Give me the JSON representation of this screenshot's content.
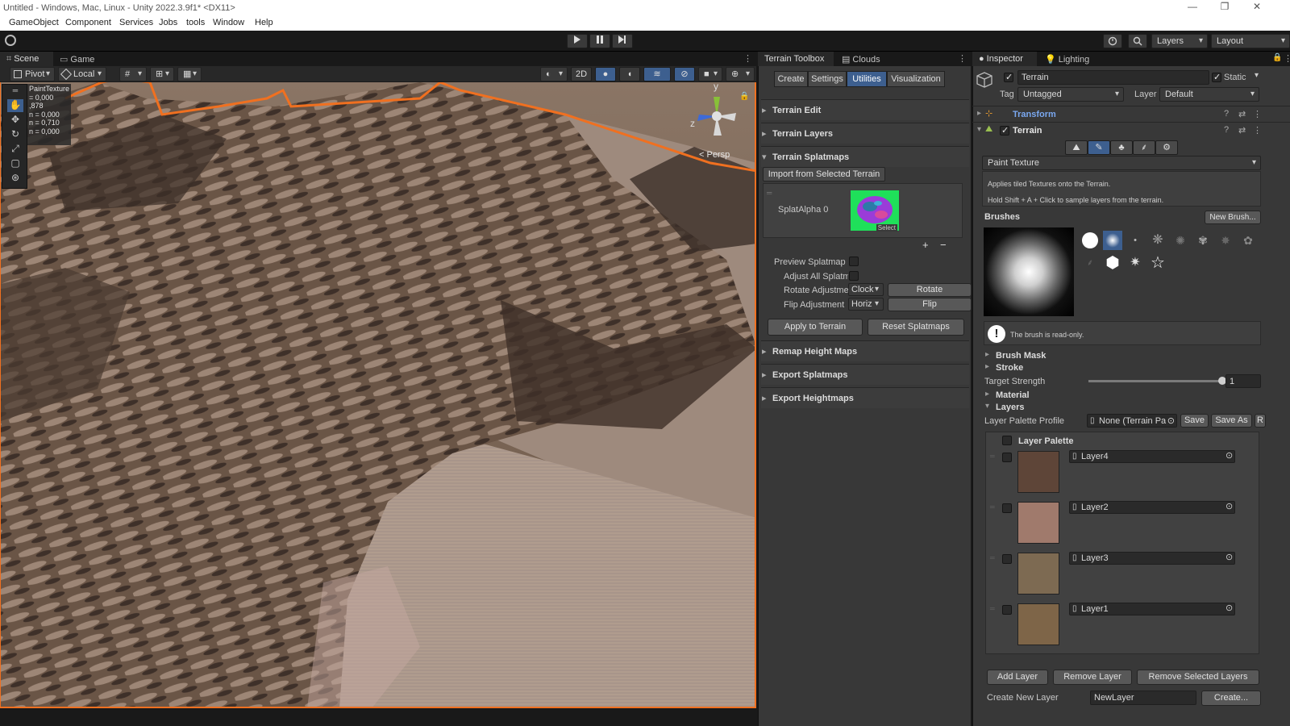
{
  "window": {
    "title": "Untitled - Windows, Mac, Linux - Unity 2022.3.9f1* <DX11>",
    "minimize_glyph": "—",
    "restore_glyph": "❐",
    "close_glyph": "✕"
  },
  "menu": [
    "GameObject",
    "Component",
    "Services",
    "Jobs",
    "tools",
    "Window",
    "Help"
  ],
  "toolbar": {
    "play_icon": "play-icon",
    "layers_label": "Layers",
    "layout_label": "Layout"
  },
  "scene": {
    "tab_scene": "Scene",
    "tab_game": "Game",
    "pivot_label": "Pivot",
    "local_label": "Local",
    "mode_2d": "2D",
    "persp_label": "< Persp",
    "gizmo_y": "y",
    "gizmo_z": "z",
    "info": [
      "PaintTexture",
      "= 0,000",
      ",878",
      "n = 0,000",
      "n = 0,710",
      "n = 0,000"
    ]
  },
  "toolbox": {
    "tab_terrain_toolbox": "Terrain Toolbox",
    "tab_clouds": "Clouds",
    "segments": [
      "Create",
      "Settings",
      "Utilities",
      "Visualization"
    ],
    "active_segment": "Utilities",
    "sections": {
      "terrain_edit": "Terrain Edit",
      "terrain_layers": "Terrain Layers",
      "terrain_splatmaps": "Terrain Splatmaps",
      "remap_height_maps": "Remap Height Maps",
      "export_splatmaps": "Export Splatmaps",
      "export_heightmaps": "Export Heightmaps"
    },
    "import_button": "Import from Selected Terrain",
    "splat_label": "SplatAlpha 0",
    "select_label": "Select",
    "plus": "+",
    "minus": "−",
    "preview_splatmap": "Preview Splatmap",
    "adjust_all": "Adjust All Splatm",
    "rotate_adjust": "Rotate Adjustme",
    "rotate_dir": "Clock",
    "rotate_button": "Rotate",
    "flip_adjust": "Flip Adjustment",
    "flip_dir": "Horiz",
    "flip_button": "Flip",
    "apply_button": "Apply to Terrain",
    "reset_button": "Reset Splatmaps"
  },
  "inspector": {
    "tab_inspector": "Inspector",
    "tab_lighting": "Lighting",
    "object_name": "Terrain",
    "static_label": "Static",
    "tag_label": "Tag",
    "tag_value": "Untagged",
    "layer_label": "Layer",
    "layer_value": "Default",
    "transform_label": "Transform",
    "terrain_component": "Terrain",
    "tool_dropdown": "Paint Texture",
    "help_line1": "Applies tiled Textures onto the Terrain.",
    "help_line2": "Hold Shift + A + Click to sample layers from the terrain.",
    "brushes_label": "Brushes",
    "new_brush": "New Brush...",
    "readonly_note": "The brush is read-only.",
    "brush_mask": "Brush Mask",
    "stroke": "Stroke",
    "target_strength": "Target Strength",
    "target_strength_value": "1",
    "target_strength_fraction": 1.0,
    "material": "Material",
    "layers": "Layers",
    "palette_profile_label": "Layer Palette Profile",
    "palette_profile_value": "None (Terrain Pa",
    "save": "Save",
    "save_as": "Save As",
    "r": "R",
    "layer_palette": "Layer Palette",
    "layer_items": [
      {
        "name": "Layer4",
        "color": "#5e4538"
      },
      {
        "name": "Layer2",
        "color": "#a07a6c"
      },
      {
        "name": "Layer3",
        "color": "#7d6a52"
      },
      {
        "name": "Layer1",
        "color": "#7e6548"
      }
    ],
    "add_layer": "Add Layer",
    "remove_layer": "Remove Layer",
    "remove_selected": "Remove Selected Layers",
    "create_new_layer": "Create New Layer",
    "new_layer_value": "NewLayer",
    "create_button": "Create..."
  },
  "colors": {
    "accent_blue": "#3d5f8f",
    "selection_orange": "#f07020",
    "panel_bg": "#383838"
  }
}
